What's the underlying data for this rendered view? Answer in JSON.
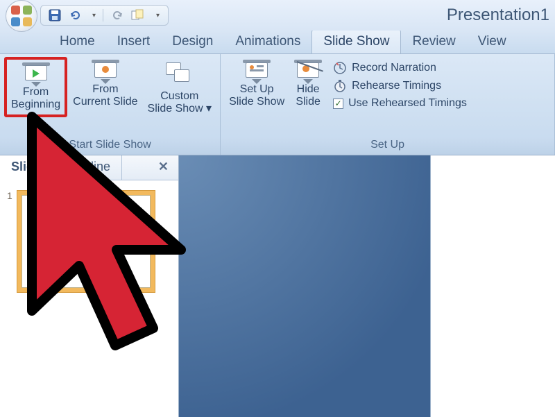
{
  "title": "Presentation1",
  "qat": {
    "save": "save",
    "undo": "undo",
    "redo": "redo",
    "repeat": "repeat"
  },
  "tabs": {
    "home": "Home",
    "insert": "Insert",
    "design": "Design",
    "animations": "Animations",
    "slideshow": "Slide Show",
    "review": "Review",
    "view": "View"
  },
  "ribbon": {
    "start_group_label": "Start Slide Show",
    "from_beginning": "From\nBeginning",
    "from_current": "From\nCurrent Slide",
    "custom_show": "Custom\nSlide Show",
    "setup_group_label": "Set Up",
    "setup_show": "Set Up\nSlide Show",
    "hide_slide": "Hide\nSlide",
    "record_narration": "Record Narration",
    "rehearse_timings": "Rehearse Timings",
    "use_rehearsed": "Use Rehearsed Timings",
    "use_rehearsed_checked": true
  },
  "pane": {
    "slides_tab": "Slides",
    "outline_tab": "Outline",
    "thumb_number": "1"
  }
}
